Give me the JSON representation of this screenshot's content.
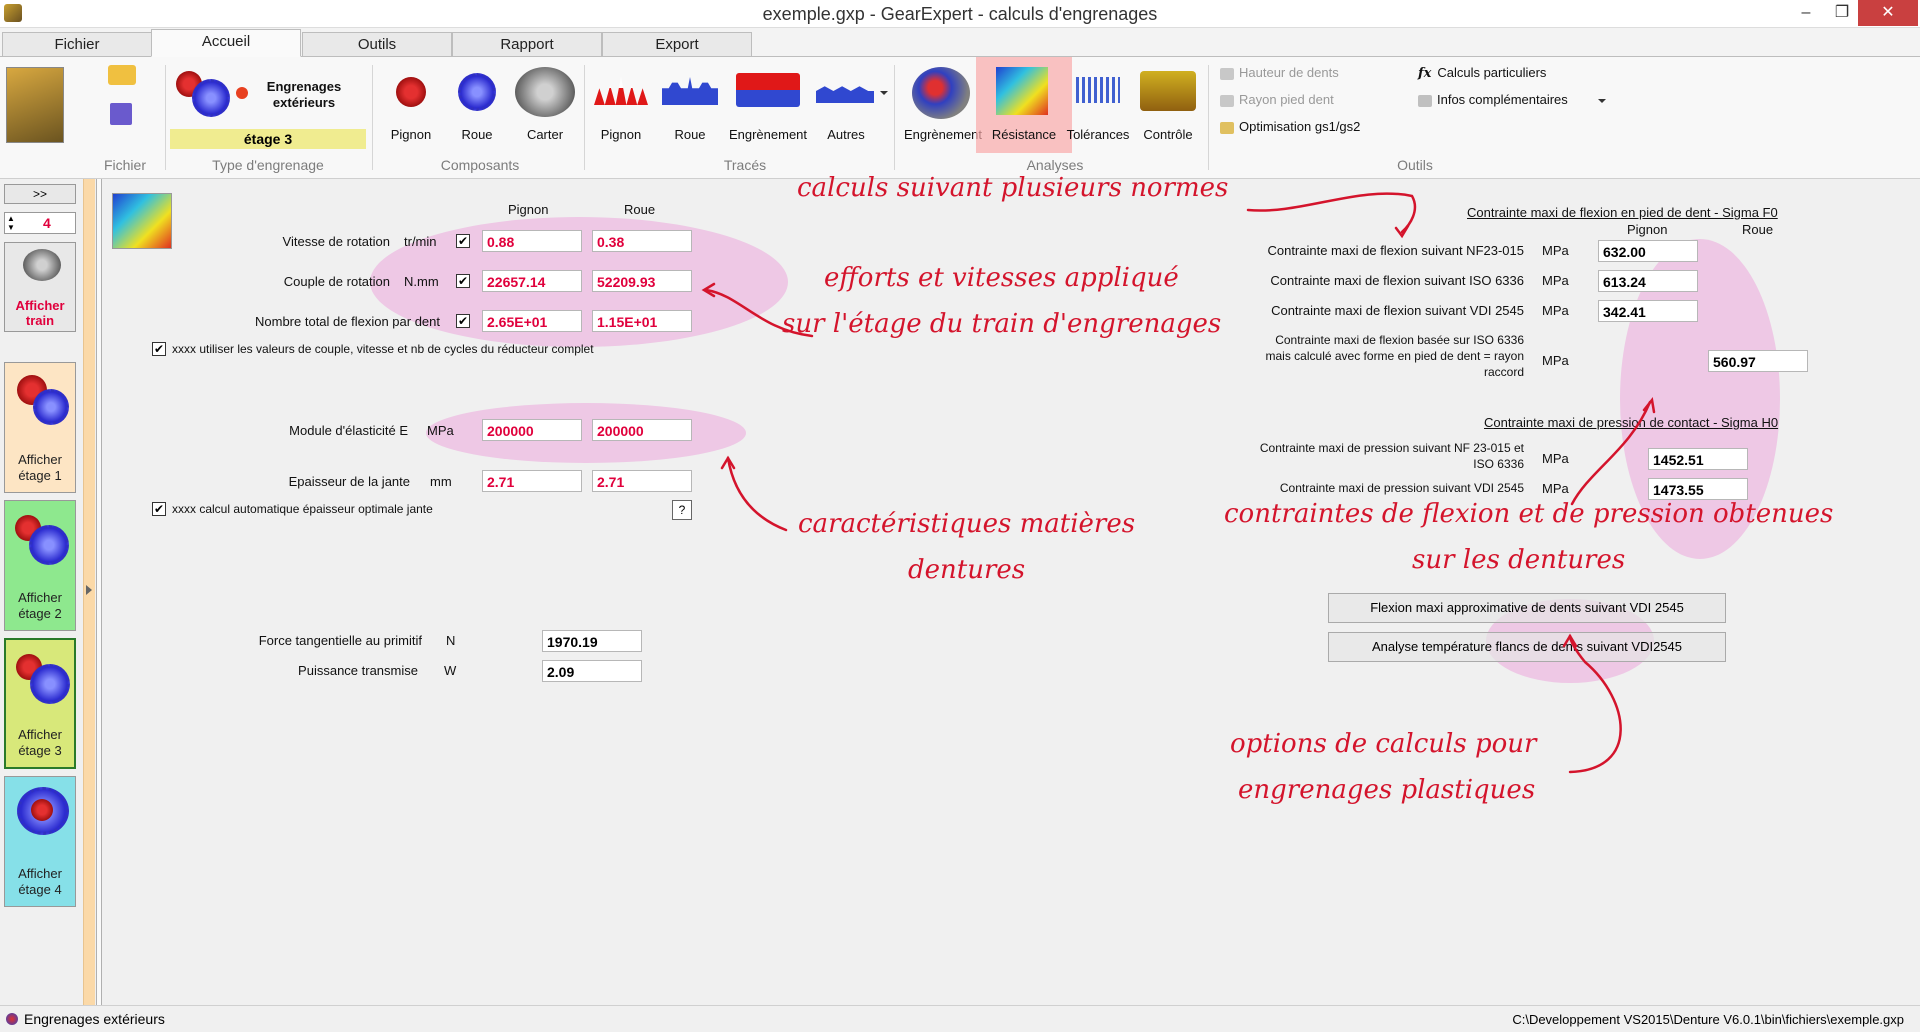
{
  "window": {
    "title": "exemple.gxp - GearExpert - calculs d'engrenages",
    "min": "–",
    "max": "❐",
    "close": "✕"
  },
  "tabs": [
    "Fichier",
    "Accueil",
    "Outils",
    "Rapport",
    "Export"
  ],
  "ribbon": {
    "groups": {
      "fichier": "Fichier",
      "type": "Type d'engrenage",
      "composants": "Composants",
      "traces": "Tracés",
      "analyses": "Analyses",
      "outils": "Outils"
    },
    "engrenage_type": "Engrenages extérieurs",
    "stage_badge": "étage 3",
    "composants": [
      "Pignon",
      "Roue",
      "Carter"
    ],
    "traces": [
      "Pignon",
      "Roue",
      "Engrènement",
      "Autres"
    ],
    "analyses": [
      "Engrènement",
      "Résistance",
      "Tolérances",
      "Contrôle"
    ],
    "outils_disabled": [
      "Hauteur de dents",
      "Rayon pied dent"
    ],
    "optimisation": "Optimisation gs1/gs2",
    "calculs_particuliers": "Calculs particuliers",
    "infos": "Infos complémentaires",
    "fx": "fx"
  },
  "sidebar": {
    "expand": ">>",
    "stage_count": "4",
    "afficher_train": "Afficher train",
    "stages": [
      "Afficher étage 1",
      "Afficher étage 2",
      "Afficher étage 3",
      "Afficher étage 4"
    ],
    "stage_colors": [
      "#fde5c4",
      "#8ee88e",
      "#d8e87a",
      "#86e0e8"
    ]
  },
  "form": {
    "col_pignon": "Pignon",
    "col_roue": "Roue",
    "rows": [
      {
        "label": "Vitesse de rotation",
        "unit": "tr/min",
        "pignon": "0.88",
        "roue": "0.38"
      },
      {
        "label": "Couple de rotation",
        "unit": "N.mm",
        "pignon": "22657.14",
        "roue": "52209.93"
      },
      {
        "label": "Nombre total de flexion par dent",
        "unit": "",
        "pignon": "2.65E+01",
        "roue": "1.15E+01"
      }
    ],
    "use_reducer": "xxxx utiliser les valeurs de couple, vitesse et nb de cycles du réducteur complet",
    "module": {
      "label": "Module d'élasticité E",
      "unit": "MPa",
      "pignon": "200000",
      "roue": "200000"
    },
    "jante": {
      "label": "Epaisseur de la jante",
      "unit": "mm",
      "pignon": "2.71",
      "roue": "2.71"
    },
    "auto_jante": "xxxx calcul automatique épaisseur optimale jante",
    "help": "?",
    "force": {
      "label": "Force tangentielle au primitif",
      "unit": "N",
      "value": "1970.19"
    },
    "puissance": {
      "label": "Puissance transmise",
      "unit": "W",
      "value": "2.09"
    }
  },
  "results": {
    "flexion_title": "Contrainte maxi de flexion en pied de dent - Sigma F0",
    "col_pignon": "Pignon",
    "col_roue": "Roue",
    "flexion": [
      {
        "label": "Contrainte maxi de flexion suivant NF23-015",
        "unit": "MPa",
        "value": "632.00"
      },
      {
        "label": "Contrainte maxi de flexion suivant ISO 6336",
        "unit": "MPa",
        "value": "613.24"
      },
      {
        "label": "Contrainte maxi de flexion suivant VDI 2545",
        "unit": "MPa",
        "value": "342.41"
      }
    ],
    "flexion_iso_l1": "Contrainte maxi de flexion basée sur ISO 6336",
    "flexion_iso_l2": "mais calculé avec forme en pied de dent = rayon",
    "flexion_iso_l3": "raccord",
    "flexion_iso_unit": "MPa",
    "flexion_iso_value": "560.97",
    "contact_title": "Contrainte maxi de pression de contact - Sigma H0",
    "contact_nf_l1": "Contrainte maxi de pression suivant NF 23-015 et",
    "contact_nf_l2": "ISO 6336",
    "contact_nf_unit": "MPa",
    "contact_nf_value": "1452.51",
    "contact_vdi_label": "Contrainte maxi de pression suivant VDI 2545",
    "contact_vdi_unit": "MPa",
    "contact_vdi_value": "1473.55",
    "btn_flexion": "Flexion maxi approximative de dents suivant VDI 2545",
    "btn_temp": "Analyse température flancs de dents suivant VDI2545"
  },
  "annotations": {
    "normes": "calculs suivant plusieurs normes",
    "efforts_1": "efforts et vitesses appliqué",
    "efforts_2": "sur l'étage du train d'engrenages",
    "matieres_1": "caractéristiques matières",
    "matieres_2": "dentures",
    "contraintes_1": "contraintes de flexion et de pression obtenues",
    "contraintes_2": "sur les dentures",
    "options_1": "options de calculs pour",
    "options_2": "engrenages plastiques"
  },
  "status": {
    "left": "Engrenages extérieurs",
    "right": "C:\\Developpement VS2015\\Denture V6.0.1\\bin\\fichiers\\exemple.gxp"
  }
}
